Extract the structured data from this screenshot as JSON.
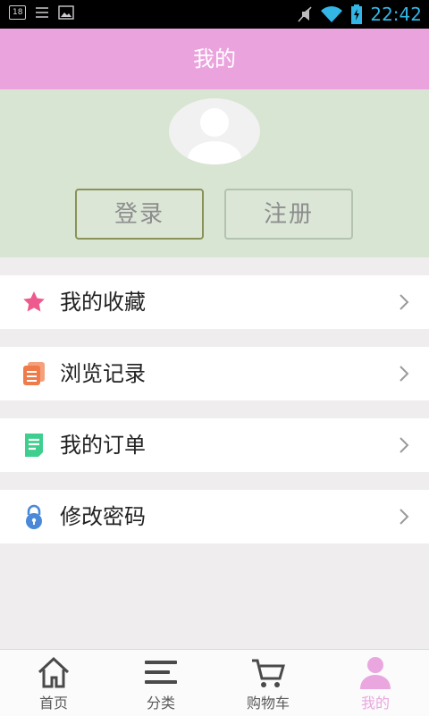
{
  "status_bar": {
    "notification_count": "18",
    "time": "22:42"
  },
  "header": {
    "title": "我的"
  },
  "profile": {
    "login_label": "登录",
    "register_label": "注册"
  },
  "menu": [
    {
      "label": "我的收藏",
      "icon": "star-icon",
      "color": "#ee5a8d"
    },
    {
      "label": "浏览记录",
      "icon": "history-icon",
      "color": "#f07b4a"
    },
    {
      "label": "我的订单",
      "icon": "order-icon",
      "color": "#3ecf8e"
    },
    {
      "label": "修改密码",
      "icon": "lock-icon",
      "color": "#4a89d8"
    }
  ],
  "tabs": [
    {
      "label": "首页",
      "icon": "home-icon"
    },
    {
      "label": "分类",
      "icon": "category-icon"
    },
    {
      "label": "购物车",
      "icon": "cart-icon"
    },
    {
      "label": "我的",
      "icon": "user-icon",
      "active": true
    }
  ],
  "colors": {
    "header": "#eba3de",
    "profile_bg": "#d8e5d2",
    "active_tab": "#eaa7df"
  }
}
